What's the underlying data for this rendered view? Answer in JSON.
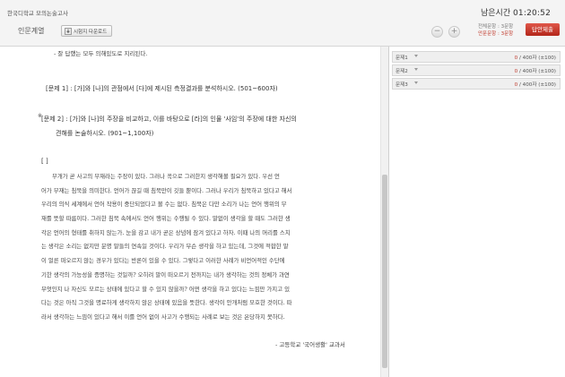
{
  "header": {
    "app_title": "한국디학교 모의논술고사",
    "category": "인문계열",
    "download_label": "시험지 다운로드",
    "zoom_out_label": "−",
    "zoom_in_label": "+",
    "timer_label": "남은시간",
    "timer_value": "01:20:52",
    "total_questions_text": "전체문항 : 3문항",
    "unanswered_text": "안푼문항 : 3문항",
    "submit_label": "답안제출"
  },
  "document": {
    "cut_line": "- 잘 답했는 모두 의해있도로 지리된다.",
    "question1": "[문제 1] : [가]와 [나]의 관점에서 [다]에 제시된 측정결과를 분석하시오. (501~600자)",
    "question2_marker": "※",
    "question2_line1": "[문제 2] : [가]와 [나]의 주장을 비교하고, 이를 바탕으로 [라]의 인물 '사임'의 주장에 대한 자신의",
    "question2_line2": "견해를 논술하시오. (901~1,100자)",
    "passage_bracket": "[    ]",
    "passage_lines": [
      "부개가 곧 사고의 부재라는 주장이 있다. 그러나 꼭으로 그러한지 생각해볼 필요가 있다. 우선 언",
      "어가 부재는 침묵을 의미한다. 언어가 끊길 때 침묵만이 깃들 뿐이다. 그러나 우리가 침묵하고 있다고 해서",
      "우리의 의식 세계에서 언어 작용이 중단되었다고 볼 수는 없다. 침묵은 다만 소리가 나는 언어 행위의 부",
      "재를 뜻할 따름이다. 그러한 침묵 속에서도 언어 행위는 수행될 수 있다. 말없이 생각을 할 때도 그러한 생",
      "각은 언어의 형태를 취하지 않는가. 눈을 감고 내가 곧은 상념에 잠겨 있다고 하자. 이때 나의 머리를 스치",
      "는 생각은 소리는 없지만 분명 말들의 연속일 것이다. 우리가 무슨 생각을 하고 있는데, 그것에 적합한 말",
      "이 얼른 떠오르지 않는 경우가 있다는 반론이 있을 수 있다. 그렇다고 이러한 사례가 비언어적인 수단에",
      "기한 생각의 가능성을 증명하는 것일까? 오히려 말이 떠오르기 전까지는 내가 생각하는 것의 정체가 과연",
      "무엇인지 나 자신도 모르는 상태에 있다고 할 수 있지 않을까? 어떤 생각을 하고 있다는 느낌만 가지고 있",
      "다는 것은 아직 그것을 명료하게 생각하지 않은 상태에 있음을 뜻한다. 생각이 안개처럼 모호한 것이다. 따",
      "라서 생각하는 느낌이 있다고 해서 이를 언어 없이 사고가 수행되는 사례로 보는 것은 온당하지 못하다."
    ],
    "source": "- 고등학교 '국어생활' 교과서"
  },
  "answers": [
    {
      "label": "문제1",
      "count": "0",
      "limit": " / 400자 (±100)"
    },
    {
      "label": "문제2",
      "count": "0",
      "limit": " / 400자 (±100)"
    },
    {
      "label": "문제3",
      "count": "0",
      "limit": " / 400자 (±100)"
    }
  ],
  "colors": {
    "accent": "#c0392b",
    "submit": "#c4362a",
    "panel_bg": "#f4f4f4"
  },
  "icons": [
    "download-icon",
    "zoom-out-icon",
    "zoom-in-icon",
    "dropdown-caret-icon"
  ]
}
